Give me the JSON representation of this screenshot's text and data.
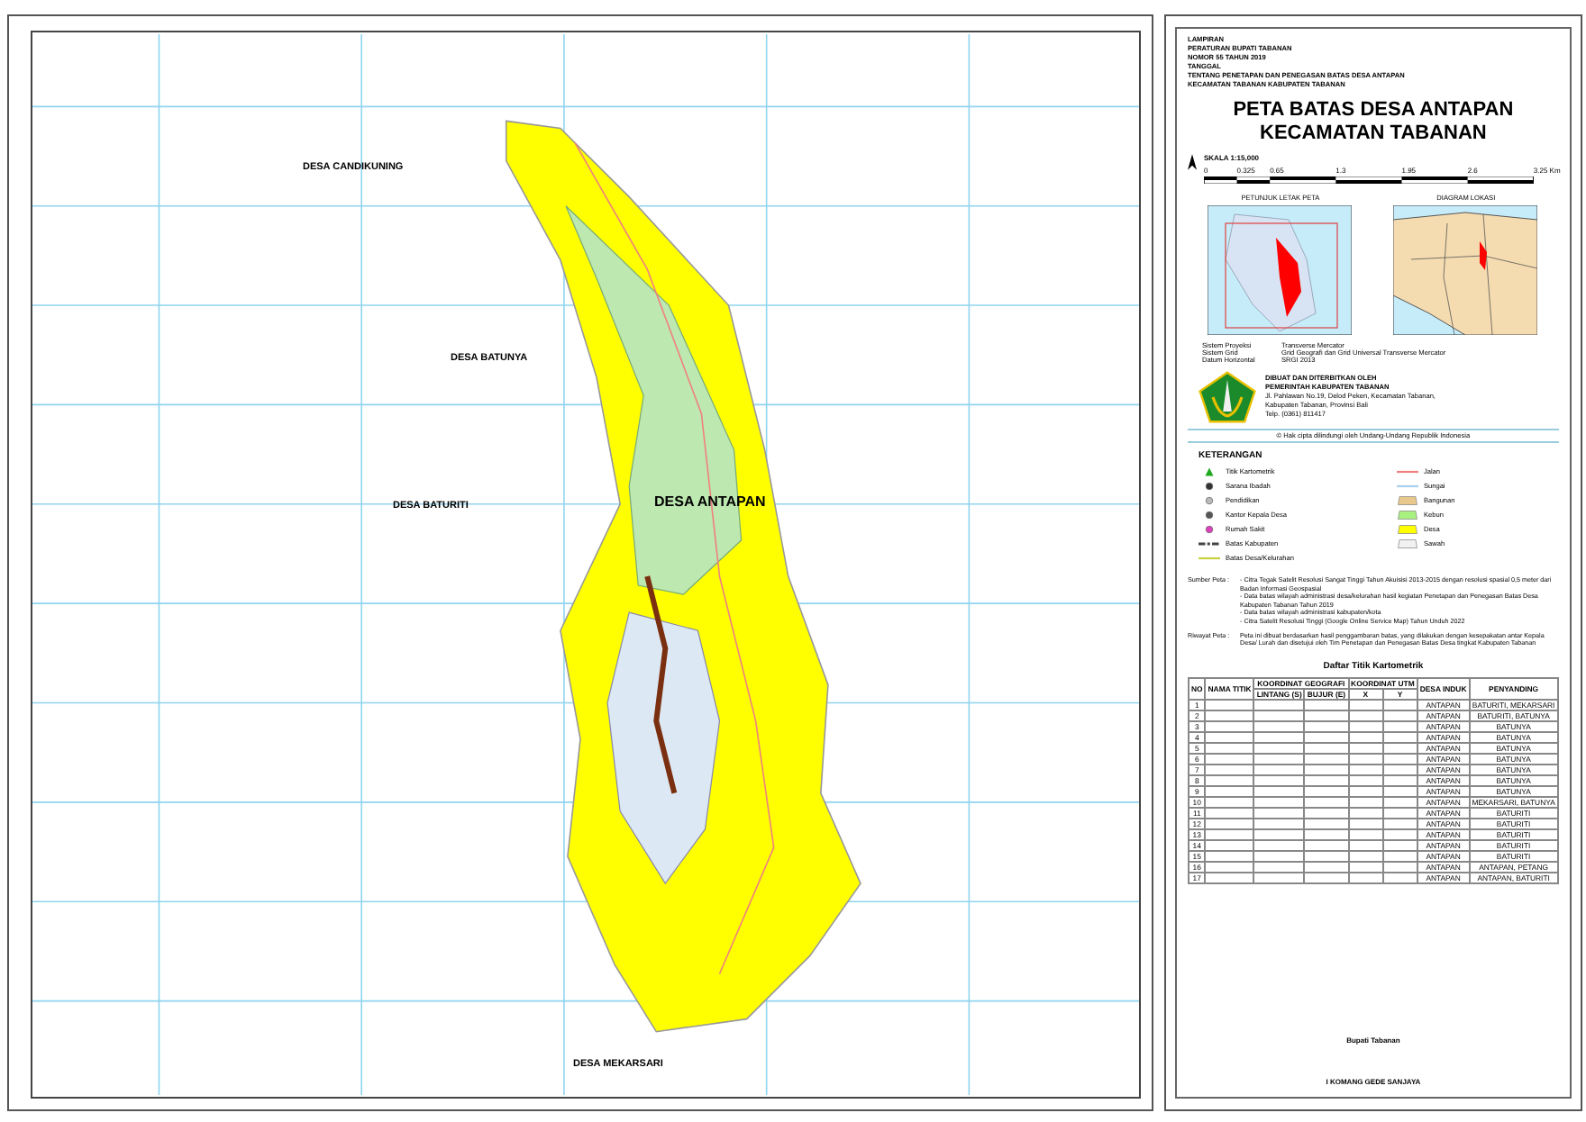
{
  "map": {
    "labels": [
      "DESA CANDIKUNING",
      "DESA BATUNYA",
      "DESA BATURITI",
      "DESA ANTAPAN",
      "DESA MEKARSARI"
    ]
  },
  "header": {
    "lines": [
      "LAMPIRAN",
      "PERATURAN BUPATI TABANAN",
      "NOMOR 55 TAHUN 2019",
      "TANGGAL",
      "TENTANG PENETAPAN DAN PENEGASAN BATAS DESA ANTAPAN",
      "KECAMATAN TABANAN KABUPATEN TABANAN"
    ],
    "title": [
      "PETA BATAS DESA ANTAPAN",
      "KECAMATAN TABANAN"
    ],
    "scale": "SKALA 1:15,000",
    "scale_ticks": [
      "0",
      "0.325",
      "0.65",
      "1.3",
      "1.95",
      "2.6",
      "3.25 Km"
    ]
  },
  "insets": [
    "PETUNJUK LETAK PETA",
    "DIAGRAM LOKASI"
  ],
  "projection": [
    {
      "label": "Sistem Proyeksi",
      "value": "Transverse Mercator"
    },
    {
      "label": "Sistem Grid",
      "value": "Grid Geografi dan Grid Universal Transverse Mercator"
    },
    {
      "label": "Datum Horizontal",
      "value": "SRGI 2013"
    }
  ],
  "publisher": [
    "DIBUAT DAN DITERBITKAN OLEH",
    "PEMERINTAH KABUPATEN TABANAN",
    "Jl. Pahlawan No.19, Delod Peken, Kecamatan Tabanan,",
    "Kabupaten Tabanan, Provinsi Bali",
    "Telp. (0361) 811417"
  ],
  "copyright": "© Hak cipta dilindungi oleh Undang-Undang Republik Indonesia",
  "legend": {
    "title": "KETERANGAN",
    "left": [
      {
        "kind": "triangle",
        "color": "#1fa81f",
        "label": "Titik Kartometrik"
      },
      {
        "kind": "point",
        "color": "#333333",
        "label": "Sarana Ibadah"
      },
      {
        "kind": "point",
        "color": "#bbbbbb",
        "label": "Pendidikan"
      },
      {
        "kind": "point",
        "color": "#555555",
        "label": "Kantor Kepala Desa"
      },
      {
        "kind": "point",
        "color": "#e040c0",
        "label": "Rumah Sakit"
      },
      {
        "kind": "dash",
        "color": "#444444",
        "label": "Batas Kabupaten"
      },
      {
        "kind": "line",
        "color": "#c8d040",
        "label": "Batas Desa/Kelurahan"
      }
    ],
    "right": [
      {
        "kind": "line",
        "color": "#f08080",
        "label": "Jalan"
      },
      {
        "kind": "line",
        "color": "#a8d0f0",
        "label": "Sungai"
      },
      {
        "kind": "area",
        "color": "#e8c88c",
        "label": "Bangunan"
      },
      {
        "kind": "area",
        "color": "#a8f080",
        "label": "Kebun"
      },
      {
        "kind": "area",
        "color": "#ffff00",
        "label": "Desa"
      },
      {
        "kind": "area",
        "color": "#f2f2f2",
        "label": "Sawah"
      }
    ]
  },
  "sources": [
    {
      "label": "Sumber Peta :",
      "lines": [
        "- Citra Tegak Satelit Resolusi Sangat Tinggi Tahun Akuisisi 2013-2015 dengan resolusi spasial 0,5 meter dari Badan Informasi Geospasial",
        "- Data batas wilayah administrasi desa/kelurahan hasil kegiatan Penetapan dan Penegasan Batas Desa Kabupaten Tabanan Tahun 2019",
        "- Data batas wilayah administrasi kabupaten/kota",
        "- Citra Satelit Resolusi Tinggi (Google Online Service Map) Tahun Unduh 2022"
      ]
    },
    {
      "label": "Riwayat Peta :",
      "lines": [
        "Peta ini dibuat berdasarkan hasil penggambaran batas, yang dilakukan dengan kesepakatan antar Kepala Desa/ Lurah dan disetujui oleh Tim Penetapan dan Penegasan Batas Desa tingkat Kabupaten Tabanan"
      ]
    }
  ],
  "table": {
    "title": "Daftar Titik Kartometrik",
    "columns": [
      "NO",
      "NAMA TITIK",
      "KOORDINAT GEOGRAFI",
      "LINTANG (S)",
      "BUJUR (E)",
      "KOORDINAT UTM",
      "X",
      "Y",
      "DESA INDUK",
      "PENYANDING"
    ],
    "rows": [
      {
        "no": "1",
        "desa": "ANTAPAN",
        "penyanding": "BATURITI, MEKARSARI"
      },
      {
        "no": "2",
        "desa": "ANTAPAN",
        "penyanding": "BATURITI, BATUNYA"
      },
      {
        "no": "3",
        "desa": "ANTAPAN",
        "penyanding": "BATUNYA"
      },
      {
        "no": "4",
        "desa": "ANTAPAN",
        "penyanding": "BATUNYA"
      },
      {
        "no": "5",
        "desa": "ANTAPAN",
        "penyanding": "BATUNYA"
      },
      {
        "no": "6",
        "desa": "ANTAPAN",
        "penyanding": "BATUNYA"
      },
      {
        "no": "7",
        "desa": "ANTAPAN",
        "penyanding": "BATUNYA"
      },
      {
        "no": "8",
        "desa": "ANTAPAN",
        "penyanding": "BATUNYA"
      },
      {
        "no": "9",
        "desa": "ANTAPAN",
        "penyanding": "BATUNYA"
      },
      {
        "no": "10",
        "desa": "ANTAPAN",
        "penyanding": "MEKARSARI, BATUNYA"
      },
      {
        "no": "11",
        "desa": "ANTAPAN",
        "penyanding": "BATURITI"
      },
      {
        "no": "12",
        "desa": "ANTAPAN",
        "penyanding": "BATURITI"
      },
      {
        "no": "13",
        "desa": "ANTAPAN",
        "penyanding": "BATURITI"
      },
      {
        "no": "14",
        "desa": "ANTAPAN",
        "penyanding": "BATURITI"
      },
      {
        "no": "15",
        "desa": "ANTAPAN",
        "penyanding": "BATURITI"
      },
      {
        "no": "16",
        "desa": "ANTAPAN",
        "penyanding": "ANTAPAN, PETANG"
      },
      {
        "no": "17",
        "desa": "ANTAPAN",
        "penyanding": "ANTAPAN, BATURITI"
      }
    ]
  },
  "signature": {
    "office": "Bupati Tabanan",
    "name": "I KOMANG GEDE SANJAYA"
  }
}
